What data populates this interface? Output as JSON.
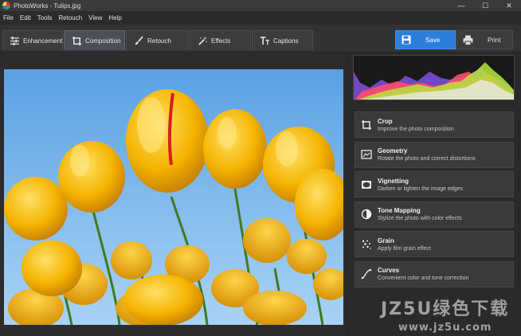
{
  "window": {
    "title": "PhotoWorks - Tulips.jpg",
    "controls": [
      "—",
      "☐",
      "✕"
    ]
  },
  "menu": [
    "File",
    "Edit",
    "Tools",
    "Retouch",
    "View",
    "Help"
  ],
  "toolbar": {
    "tabs": [
      {
        "label": "Enhancement",
        "icon": "sliders-icon",
        "active": false
      },
      {
        "label": "Composition",
        "icon": "crop-icon",
        "active": true
      },
      {
        "label": "Retouch",
        "icon": "brush-icon",
        "active": false
      },
      {
        "label": "Effects",
        "icon": "magic-wand-icon",
        "active": false
      },
      {
        "label": "Captions",
        "icon": "text-icon",
        "active": false
      }
    ],
    "save_label": "Save",
    "print_label": "Print"
  },
  "tools": [
    {
      "title": "Crop",
      "desc": "Improve the photo composition",
      "icon": "crop-icon"
    },
    {
      "title": "Geometry",
      "desc": "Rotate the photo and correct distortions",
      "icon": "geometry-icon"
    },
    {
      "title": "Vignetting",
      "desc": "Darken or lighten the image edges",
      "icon": "vignette-icon"
    },
    {
      "title": "Tone Mapping",
      "desc": "Stylize the photo with color effects",
      "icon": "tone-mapping-icon"
    },
    {
      "title": "Grain",
      "desc": "Apply film grain effect",
      "icon": "grain-icon"
    },
    {
      "title": "Curves",
      "desc": "Convenient color and tone correction",
      "icon": "curves-icon"
    }
  ],
  "watermark": {
    "line1": "JZ5U绿色下载",
    "line2": "www.jz5u.com"
  },
  "colors": {
    "accent": "#2b7fd9",
    "panel": "#3a3a3a",
    "background": "#2f2f2f"
  }
}
